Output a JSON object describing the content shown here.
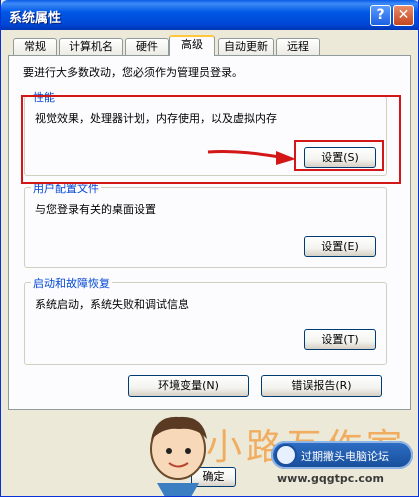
{
  "window": {
    "title": "系统属性",
    "help_label": "?",
    "close_label": "✕"
  },
  "tabs": [
    {
      "label": "常规"
    },
    {
      "label": "计算机名"
    },
    {
      "label": "硬件"
    },
    {
      "label": "高级",
      "active": true
    },
    {
      "label": "自动更新"
    },
    {
      "label": "远程"
    }
  ],
  "admin_note": "要进行大多数改动，您必须作为管理员登录。",
  "groups": {
    "performance": {
      "title": "性能",
      "description": "视觉效果，处理器计划，内存使用，以及虚拟内存",
      "button_label": "设置(S)"
    },
    "user_profiles": {
      "title": "用户配置文件",
      "description": "与您登录有关的桌面设置",
      "button_label": "设置(E)"
    },
    "startup_recovery": {
      "title": "启动和故障恢复",
      "description": "系统启动，系统失败和调试信息",
      "button_label": "设置(T)"
    }
  },
  "buttons": {
    "env_vars": "环境变量(N)",
    "error_report": "错误报告(R)",
    "ok": "确定"
  },
  "annotation": {
    "highlight_color": "#d31717"
  },
  "watermark": {
    "brand_text": "小路互作室",
    "pill_text": "过期撇头电脑论坛",
    "url": "www.gqgtpc.com"
  },
  "colors": {
    "title_bar": "#0058e6",
    "group_title": "#0046d5",
    "active_tab_accent": "#ffc83c"
  }
}
